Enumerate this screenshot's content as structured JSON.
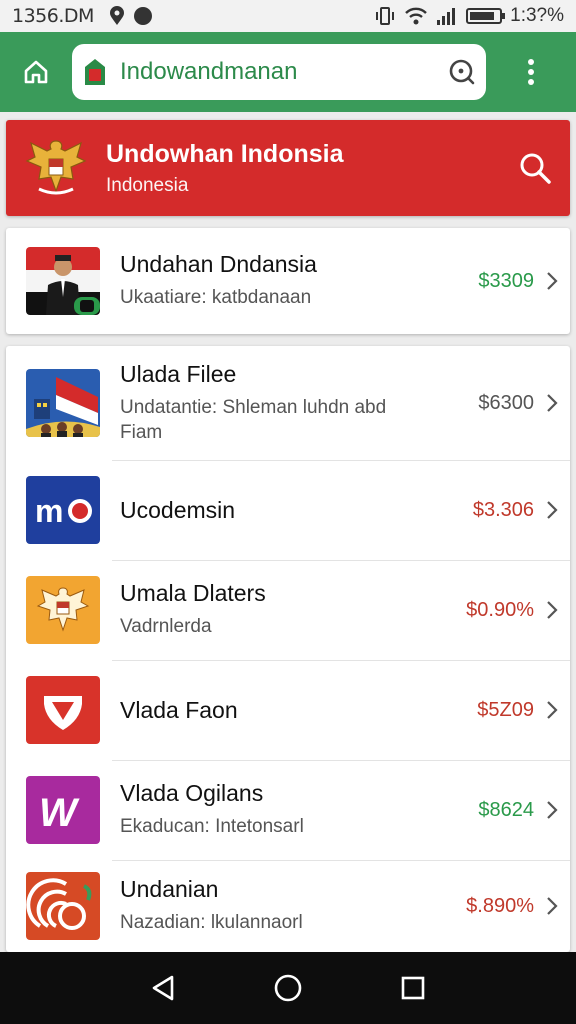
{
  "status_bar": {
    "time": "1356.DM",
    "battery_pct": "1:3?%"
  },
  "browser": {
    "url": "Indowandmanan"
  },
  "banner": {
    "title": "Undowhan Indonsia",
    "subtitle": "Indonesia"
  },
  "featured": {
    "title": "Undahan Dndansia",
    "subtitle": "Ukaatiare: katbdanaan",
    "price": "$3309",
    "price_color": "#2a9a4a"
  },
  "items": [
    {
      "title": "Ulada Filee",
      "subtitle": "Undatantie: Shleman luhdn abd Fiam",
      "price": "$6300",
      "price_color": "#555555",
      "icon": "flag-photo-icon"
    },
    {
      "title": "Ucodemsin",
      "subtitle": "",
      "price": "$3.306",
      "price_color": "#c0392b",
      "icon": "mo-logo-icon"
    },
    {
      "title": "Umala Dlaters",
      "subtitle": "Vadrnlerda",
      "price": "$0.90%",
      "price_color": "#c0392b",
      "icon": "garuda-icon"
    },
    {
      "title": "Vlada Faon",
      "subtitle": "",
      "price": "$5Z09",
      "price_color": "#c0392b",
      "icon": "shield-icon"
    },
    {
      "title": "Vlada Ogilans",
      "subtitle": "Ekaducan: Intetonsarl",
      "price": "$8624",
      "price_color": "#2a9a4a",
      "icon": "w-logo-icon"
    },
    {
      "title": "Undanian",
      "subtitle": "Nazadian: lkulannaorl",
      "price": "$.890%",
      "price_color": "#c0392b",
      "icon": "spiral-logo-icon"
    }
  ],
  "colors": {
    "toolbar": "#3a9b5a",
    "banner": "#d42b2b"
  }
}
